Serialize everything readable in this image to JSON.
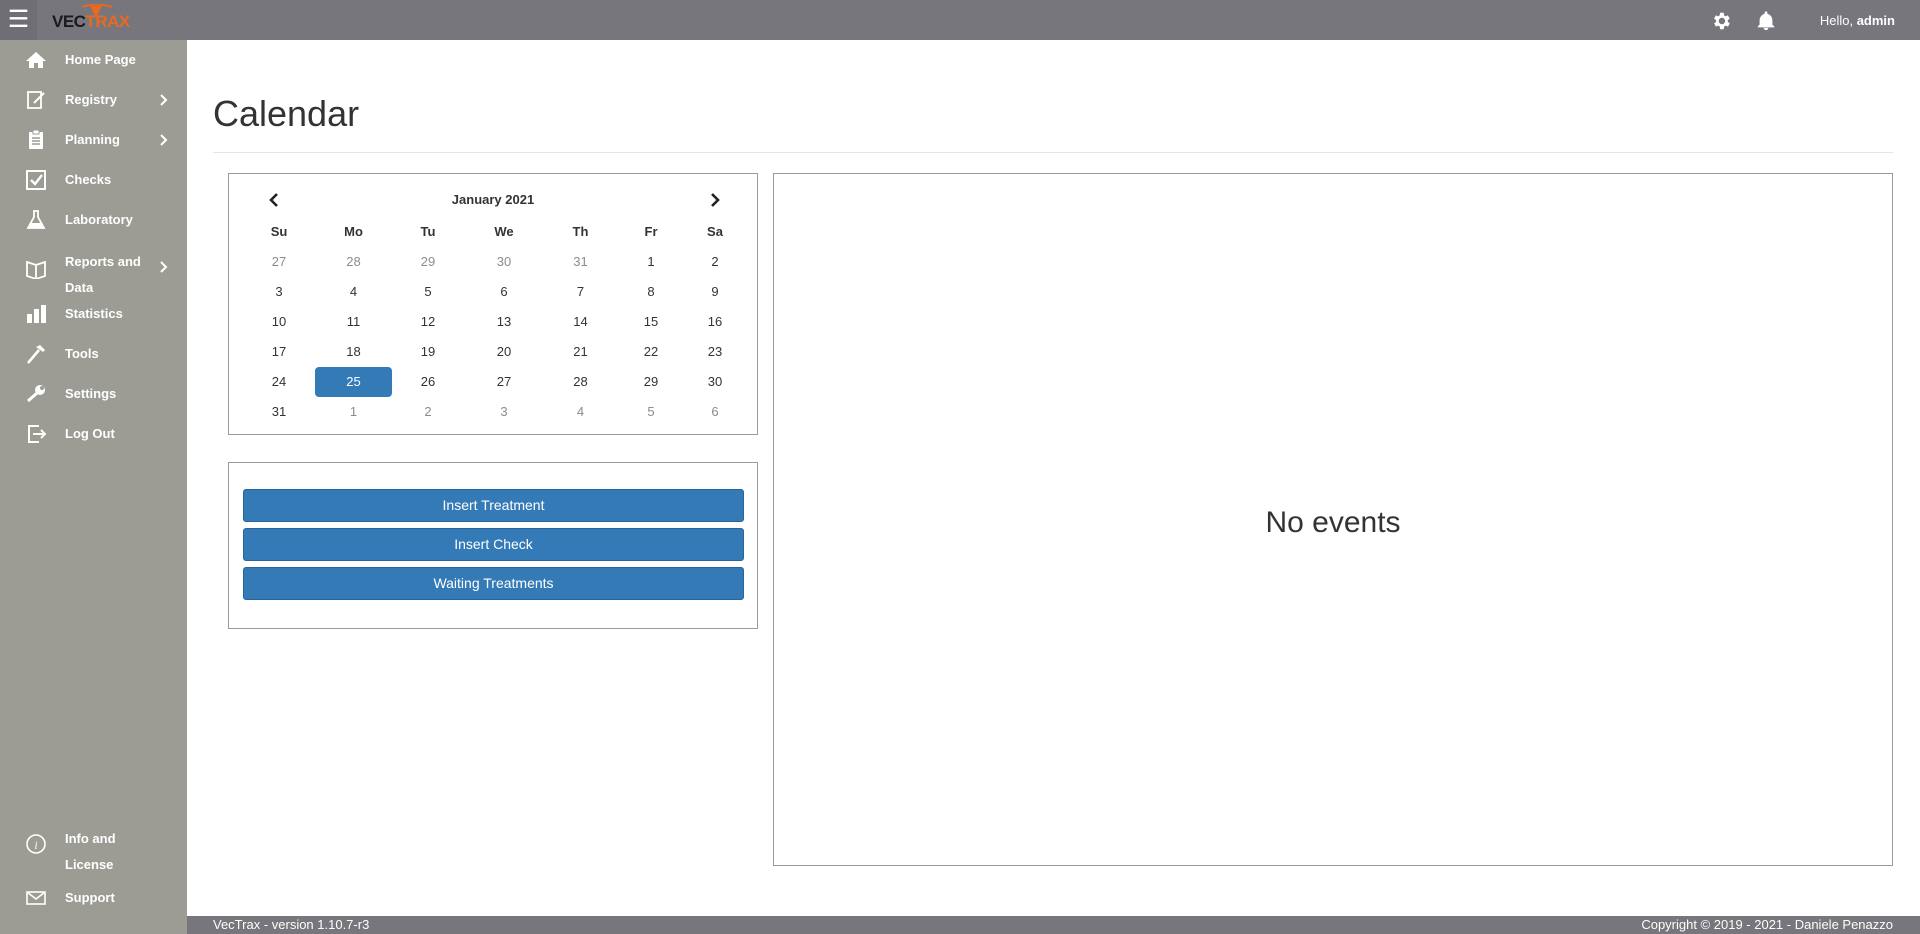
{
  "topbar": {
    "menu_glyph": "☰",
    "logo": {
      "part1": "VEC",
      "part2": "TRAX"
    },
    "greeting_prefix": "Hello, ",
    "username": "admin"
  },
  "sidebar": {
    "items": [
      {
        "label": "Home Page",
        "icon": "home-icon"
      },
      {
        "label": "Registry",
        "icon": "edit-icon",
        "submenu": true
      },
      {
        "label": "Planning",
        "icon": "clipboard-icon",
        "submenu": true
      },
      {
        "label": "Checks",
        "icon": "checkbox-icon"
      },
      {
        "label": "Laboratory",
        "icon": "flask-icon"
      },
      {
        "label": "Reports and Data",
        "icon": "book-icon",
        "submenu": true
      },
      {
        "label": "Statistics",
        "icon": "bar-chart-icon"
      },
      {
        "label": "Tools",
        "icon": "hammer-icon"
      },
      {
        "label": "Settings",
        "icon": "wrench-icon"
      },
      {
        "label": "Log Out",
        "icon": "logout-icon"
      },
      {
        "label": "Info and License",
        "icon": "info-icon"
      },
      {
        "label": "Support",
        "icon": "envelope-icon"
      }
    ]
  },
  "main": {
    "title": "Calendar",
    "calendar": {
      "month_label": "January 2021",
      "weekdays": [
        "Su",
        "Mo",
        "Tu",
        "We",
        "Th",
        "Fr",
        "Sa"
      ],
      "weeks": [
        [
          {
            "d": "27",
            "muted": true
          },
          {
            "d": "28",
            "muted": true
          },
          {
            "d": "29",
            "muted": true
          },
          {
            "d": "30",
            "muted": true
          },
          {
            "d": "31",
            "muted": true
          },
          {
            "d": "1"
          },
          {
            "d": "2"
          }
        ],
        [
          {
            "d": "3"
          },
          {
            "d": "4"
          },
          {
            "d": "5"
          },
          {
            "d": "6"
          },
          {
            "d": "7"
          },
          {
            "d": "8"
          },
          {
            "d": "9"
          }
        ],
        [
          {
            "d": "10"
          },
          {
            "d": "11"
          },
          {
            "d": "12"
          },
          {
            "d": "13"
          },
          {
            "d": "14"
          },
          {
            "d": "15"
          },
          {
            "d": "16"
          }
        ],
        [
          {
            "d": "17"
          },
          {
            "d": "18"
          },
          {
            "d": "19"
          },
          {
            "d": "20"
          },
          {
            "d": "21"
          },
          {
            "d": "22"
          },
          {
            "d": "23"
          }
        ],
        [
          {
            "d": "24"
          },
          {
            "d": "25",
            "selected": true
          },
          {
            "d": "26"
          },
          {
            "d": "27"
          },
          {
            "d": "28"
          },
          {
            "d": "29"
          },
          {
            "d": "30"
          }
        ],
        [
          {
            "d": "31"
          },
          {
            "d": "1",
            "muted": true
          },
          {
            "d": "2",
            "muted": true
          },
          {
            "d": "3",
            "muted": true
          },
          {
            "d": "4",
            "muted": true
          },
          {
            "d": "5",
            "muted": true
          },
          {
            "d": "6",
            "muted": true
          }
        ]
      ]
    },
    "actions": {
      "insert_treatment": "Insert Treatment",
      "insert_check": "Insert Check",
      "waiting_treatments": "Waiting Treatments"
    },
    "events": {
      "empty_label": "No events"
    }
  },
  "footer": {
    "version": "VecTrax - version 1.10.7-r3",
    "copyright": "Copyright © 2019 - 2021 - Daniele Penazzo"
  },
  "colors": {
    "topbar": "#76767c",
    "sidebar": "#9c9c95",
    "primary": "#337ab7",
    "logo_accent": "#e8691f"
  }
}
